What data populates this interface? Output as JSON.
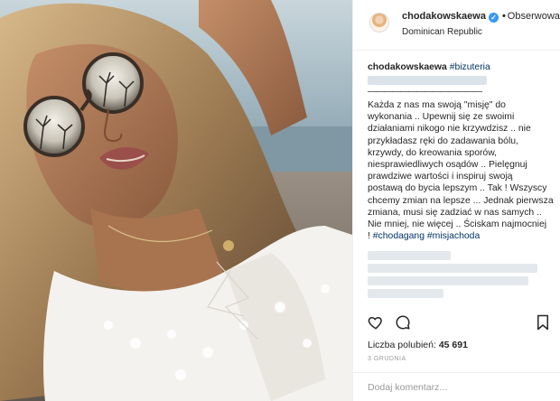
{
  "post": {
    "username": "chodakowskaewa",
    "verified_icon": "verified-badge-icon",
    "separator": "•",
    "follow_label": "Obserwowanie",
    "location": "Dominican Republic"
  },
  "caption": {
    "username": "chodakowskaewa",
    "hashtag_top": "#bizuteria",
    "divider": "——————————————",
    "lines": [
      "Każda z nas ma swoją \"misję\" do",
      "wykonania .. Upewnij się ze swoimi",
      "działaniami nikogo nie krzywdzisz .. nie",
      "przykładasz ręki do zadawania bólu,",
      "krzywdy, do kreowania sporów,",
      "niesprawiedliwych osądów .. Pielęgnuj",
      "prawdziwe wartości i inspiruj swoją",
      "postawą do bycia lepszym .. Tak ! Wszyscy",
      "chcemy zmian na lepsze ... Jednak pierwsza",
      "zmiana, musi się zadziać w nas samych ..",
      "Nie mniej, nie więcej .. Ściskam najmocniej"
    ],
    "closing_tags": [
      "!",
      "#chodagang",
      "#misjachoda"
    ]
  },
  "actions": {
    "like_icon": "heart-icon",
    "comment_icon": "comment-icon",
    "save_icon": "bookmark-icon"
  },
  "likes": {
    "label": "Liczba polubień:",
    "count": "45 691"
  },
  "date": "3 GRUDNIA",
  "comment_box": {
    "placeholder": "Dodaj komentarz..."
  },
  "colors": {
    "link": "#003569",
    "verified": "#3897f0",
    "border": "#efefef",
    "muted": "#999999"
  }
}
